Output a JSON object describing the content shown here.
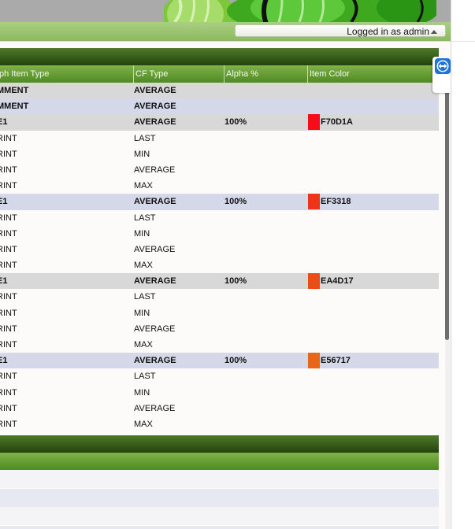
{
  "header": {
    "login_text": "Logged in as admin"
  },
  "table": {
    "columns": [
      "ph Item Type",
      "CF Type",
      "Alpha %",
      "Item Color"
    ],
    "rows": [
      {
        "style": "sel",
        "bold": true,
        "item_type": "MMENT",
        "cf_type": "AVERAGE",
        "alpha": "",
        "color_hex": "",
        "swatch": ""
      },
      {
        "style": "alt",
        "bold": true,
        "item_type": "MMENT",
        "cf_type": "AVERAGE",
        "alpha": "",
        "color_hex": "",
        "swatch": ""
      },
      {
        "style": "sel",
        "bold": true,
        "item_type": "E1",
        "cf_type": "AVERAGE",
        "alpha": "100%",
        "color_hex": "F70D1A",
        "swatch": "#F70D1A"
      },
      {
        "style": "plain",
        "bold": false,
        "item_type": "RINT",
        "cf_type": "LAST",
        "alpha": "",
        "color_hex": "",
        "swatch": ""
      },
      {
        "style": "plain",
        "bold": false,
        "item_type": "RINT",
        "cf_type": "MIN",
        "alpha": "",
        "color_hex": "",
        "swatch": ""
      },
      {
        "style": "plain",
        "bold": false,
        "item_type": "RINT",
        "cf_type": "AVERAGE",
        "alpha": "",
        "color_hex": "",
        "swatch": ""
      },
      {
        "style": "plain",
        "bold": false,
        "item_type": "RINT",
        "cf_type": "MAX",
        "alpha": "",
        "color_hex": "",
        "swatch": ""
      },
      {
        "style": "alt",
        "bold": true,
        "item_type": "E1",
        "cf_type": "AVERAGE",
        "alpha": "100%",
        "color_hex": "EF3318",
        "swatch": "#EF3318"
      },
      {
        "style": "plain",
        "bold": false,
        "item_type": "RINT",
        "cf_type": "LAST",
        "alpha": "",
        "color_hex": "",
        "swatch": ""
      },
      {
        "style": "plain",
        "bold": false,
        "item_type": "RINT",
        "cf_type": "MIN",
        "alpha": "",
        "color_hex": "",
        "swatch": ""
      },
      {
        "style": "plain",
        "bold": false,
        "item_type": "RINT",
        "cf_type": "AVERAGE",
        "alpha": "",
        "color_hex": "",
        "swatch": ""
      },
      {
        "style": "plain",
        "bold": false,
        "item_type": "RINT",
        "cf_type": "MAX",
        "alpha": "",
        "color_hex": "",
        "swatch": ""
      },
      {
        "style": "sel",
        "bold": true,
        "item_type": "E1",
        "cf_type": "AVERAGE",
        "alpha": "100%",
        "color_hex": "EA4D17",
        "swatch": "#EA4D17"
      },
      {
        "style": "plain",
        "bold": false,
        "item_type": "RINT",
        "cf_type": "LAST",
        "alpha": "",
        "color_hex": "",
        "swatch": ""
      },
      {
        "style": "plain",
        "bold": false,
        "item_type": "RINT",
        "cf_type": "MIN",
        "alpha": "",
        "color_hex": "",
        "swatch": ""
      },
      {
        "style": "plain",
        "bold": false,
        "item_type": "RINT",
        "cf_type": "AVERAGE",
        "alpha": "",
        "color_hex": "",
        "swatch": ""
      },
      {
        "style": "plain",
        "bold": false,
        "item_type": "RINT",
        "cf_type": "MAX",
        "alpha": "",
        "color_hex": "",
        "swatch": ""
      },
      {
        "style": "alt",
        "bold": true,
        "item_type": "E1",
        "cf_type": "AVERAGE",
        "alpha": "100%",
        "color_hex": "E56717",
        "swatch": "#E56717"
      },
      {
        "style": "plain",
        "bold": false,
        "item_type": "RINT",
        "cf_type": "LAST",
        "alpha": "",
        "color_hex": "",
        "swatch": ""
      },
      {
        "style": "plain",
        "bold": false,
        "item_type": "RINT",
        "cf_type": "MIN",
        "alpha": "",
        "color_hex": "",
        "swatch": ""
      },
      {
        "style": "plain",
        "bold": false,
        "item_type": "RINT",
        "cf_type": "AVERAGE",
        "alpha": "",
        "color_hex": "",
        "swatch": ""
      },
      {
        "style": "plain",
        "bold": false,
        "item_type": "RINT",
        "cf_type": "MAX",
        "alpha": "",
        "color_hex": "",
        "swatch": ""
      }
    ]
  },
  "footer_rows": [
    "#f4f4f6",
    "#e6e9f2",
    "#f4f4f6",
    "#e6e9f2"
  ],
  "icons": {
    "login_menu": "triangle-up-icon",
    "remote_support": "teamviewer-icon"
  },
  "colors": {
    "header_dark": "#24420c",
    "header_green": "#5f9a30",
    "row_selected": "#d8d8d8",
    "row_alternate": "#d4d8e8"
  }
}
